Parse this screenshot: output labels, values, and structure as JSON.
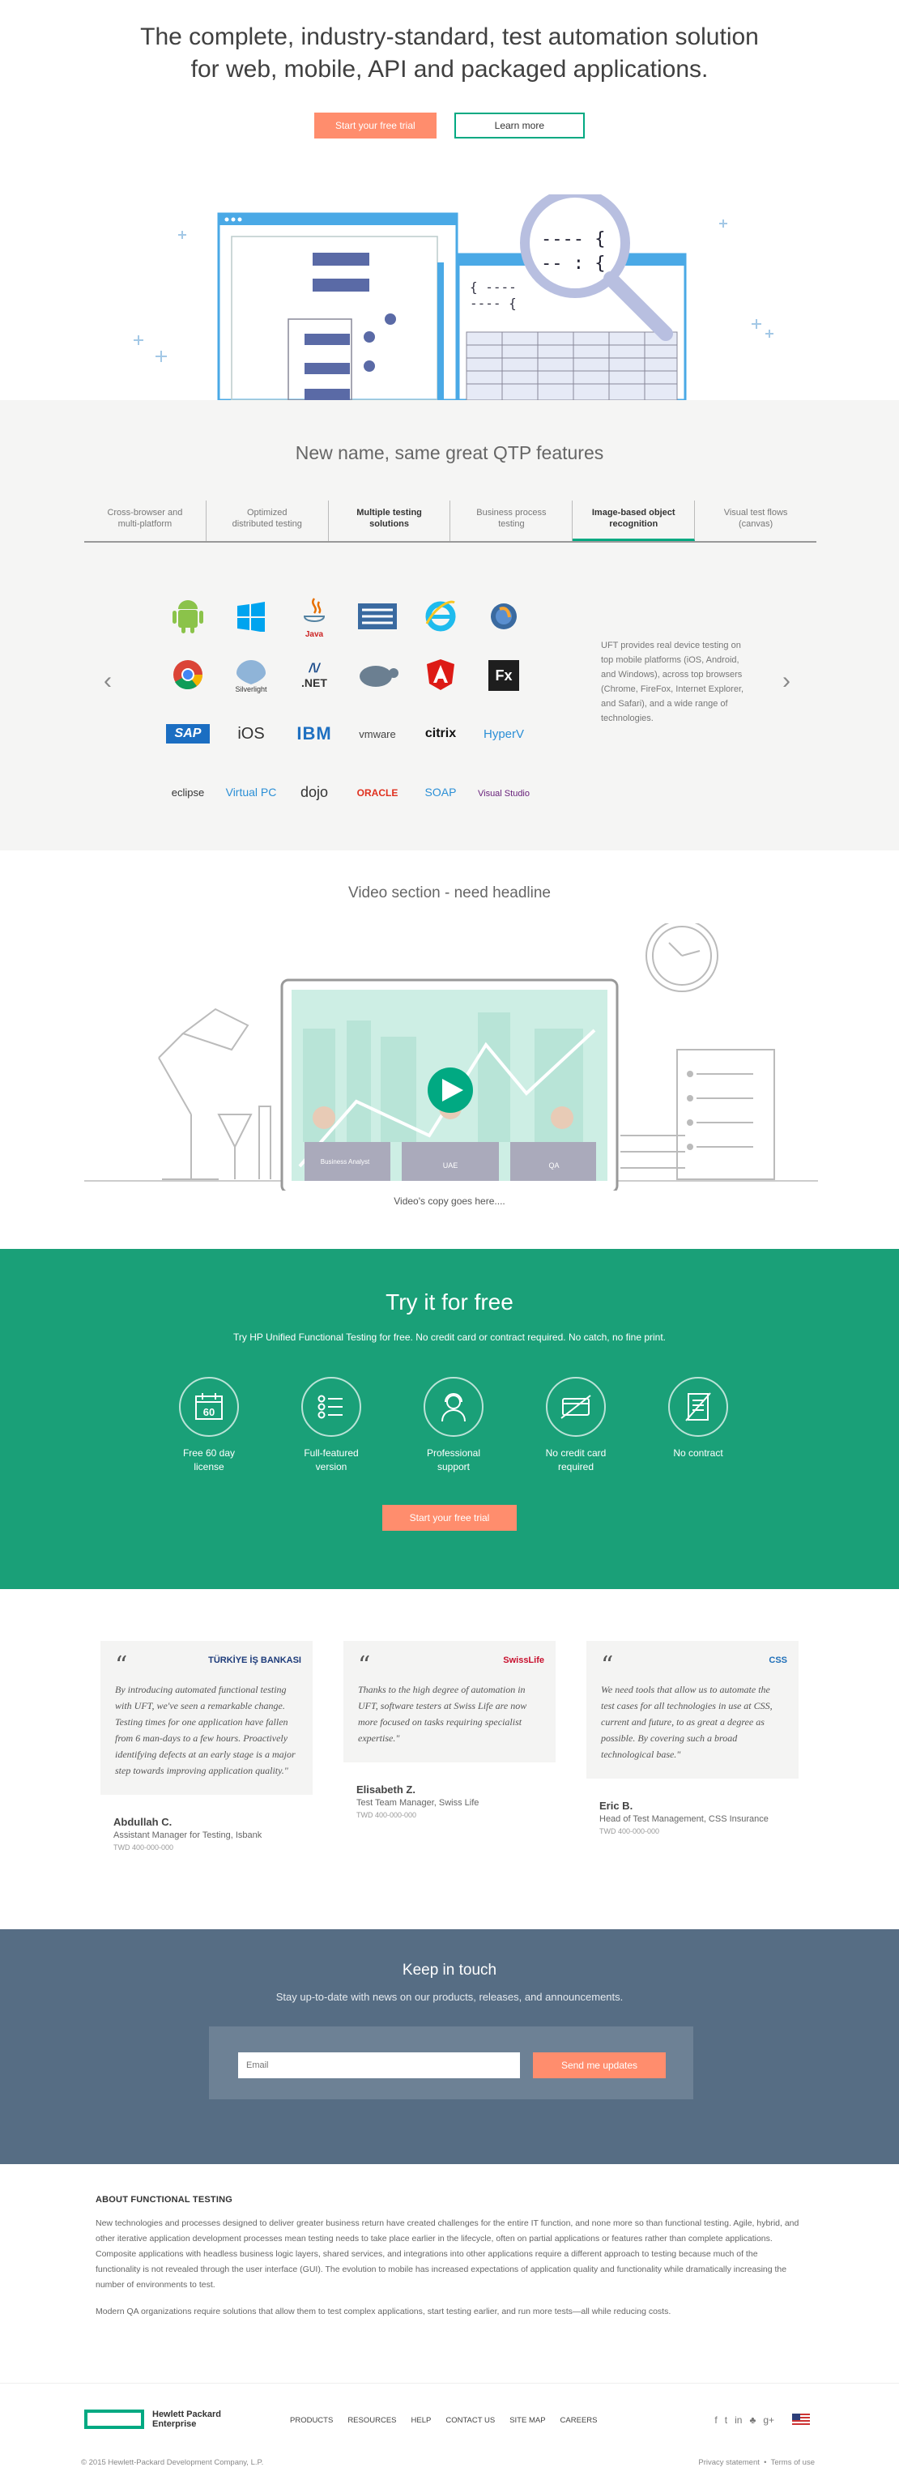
{
  "hero": {
    "title_line1": "The complete, industry-standard, test automation solution",
    "title_line2": "for web, mobile, API and packaged applications.",
    "trial_button": "Start your free trial",
    "learn_button": "Learn more"
  },
  "features": {
    "title": "New name, same great QTP features",
    "tabs": [
      {
        "l1": "Cross-browser and",
        "l2": "multi-platform"
      },
      {
        "l1": "Optimized",
        "l2": "distributed testing"
      },
      {
        "l1": "Multiple testing",
        "l2": "solutions"
      },
      {
        "l1": "Business process",
        "l2": "testing"
      },
      {
        "l1": "Image-based object",
        "l2": "recognition"
      },
      {
        "l1": "Visual test flows",
        "l2": "(canvas)"
      }
    ],
    "logos": [
      "Java",
      "Silverlight",
      ".NET",
      "SAP",
      "iOS",
      "IBM",
      "vmware",
      "citrix",
      "HyperV",
      "eclipse",
      "Virtual PC",
      "dojo",
      "ORACLE",
      "SOAP",
      "Visual Studio",
      "Fx"
    ],
    "description": "UFT provides real device testing on top mobile platforms (iOS, Android, and Windows), across top browsers (Chrome, FireFox, Internet Explorer, and Safari), and a wide range of technologies.",
    "prev_arrow": "‹",
    "next_arrow": "›"
  },
  "video": {
    "title": "Video section - need headline",
    "copy": "Video's copy goes here....",
    "labels": [
      "Business Analyst",
      "UAE",
      "QA"
    ]
  },
  "try": {
    "title": "Try it for free",
    "subtitle": "Try HP Unified Functional Testing for free. No credit card or contract required. No catch, no fine print.",
    "items": [
      {
        "l1": "Free 60 day",
        "l2": "license"
      },
      {
        "l1": "Full-featured",
        "l2": "version"
      },
      {
        "l1": "Professional",
        "l2": "support"
      },
      {
        "l1": "No credit card",
        "l2": "required"
      },
      {
        "l1": "No contract",
        "l2": ""
      }
    ],
    "calendar_number": "60",
    "button": "Start your free trial"
  },
  "testimonials": [
    {
      "company": "TÜRKİYE İŞ BANKASI",
      "quote": "By introducing automated functional testing with UFT, we've seen a remarkable change. Testing times for one application have fallen from 6 man-days to a few hours. Proactively identifying defects at an early stage is a major step towards improving application quality.\"",
      "name": "Abdullah C.",
      "title": "Assistant Manager for Testing, Isbank",
      "phone": "TWD 400-000-000"
    },
    {
      "company": "SwissLife",
      "quote": "Thanks to the high degree of automation in UFT, software testers at Swiss Life are now more focused on tasks requiring specialist expertise.\"",
      "name": "Elisabeth Z.",
      "title": "Test Team Manager, Swiss Life",
      "phone": "TWD 400-000-000"
    },
    {
      "company": "CSS",
      "quote": "We need tools that allow us to automate the test cases for all technologies in use at CSS, current and future, to as great a degree as possible. By covering such a broad technological base.\"",
      "name": "Eric B.",
      "title": "Head of Test Management, CSS Insurance",
      "phone": "TWD 400-000-000"
    }
  ],
  "quote_mark": "“",
  "keep": {
    "title": "Keep in touch",
    "subtitle": "Stay up-to-date with news on our products, releases, and announcements.",
    "email_placeholder": "Email",
    "button": "Send me updates"
  },
  "about": {
    "heading": "ABOUT FUNCTIONAL TESTING",
    "p1": "New technologies and processes designed to deliver greater business return have created challenges for the entire IT function, and none more so than functional testing. Agile, hybrid, and other iterative application development processes mean testing needs to take place earlier in the lifecycle, often on partial applications or features rather than complete applications. Composite applications with headless business logic layers, shared services, and integrations into other applications require a different approach to testing because much of the functionality is not revealed through the user interface (GUI). The evolution to mobile has increased expectations of application quality and functionality while dramatically increasing the number of environments to test.",
    "p2": "Modern QA organizations require solutions that allow them to test complex applications, start testing earlier, and run more tests—all while reducing costs."
  },
  "footer": {
    "logo_line1": "Hewlett Packard",
    "logo_line2": "Enterprise",
    "nav": [
      "PRODUCTS",
      "RESOURCES",
      "HELP",
      "CONTACT US",
      "SITE MAP",
      "CAREERS"
    ],
    "social": [
      "f",
      "t",
      "in",
      "♣",
      "g+"
    ],
    "copyright": "© 2015 Hewlett-Packard Development Company, L.P.",
    "privacy": "Privacy statement",
    "terms": "Terms of use"
  },
  "colors": {
    "accent": "#01a982",
    "orange": "#ff8d6d",
    "try_bg": "#1aa078",
    "keep_bg": "#566d84"
  }
}
